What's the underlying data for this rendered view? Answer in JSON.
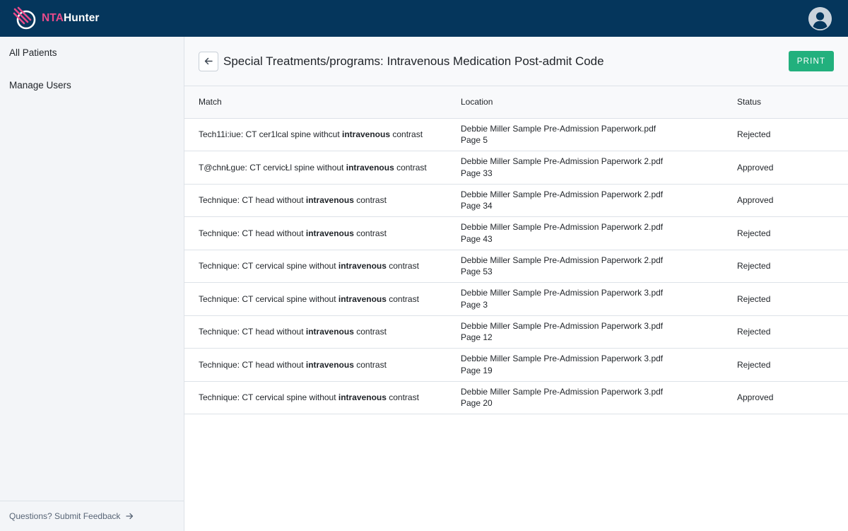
{
  "app": {
    "logo_part1": "NTA",
    "logo_part2": "Hunter",
    "colors": {
      "topbar": "#05365c",
      "accent_pink": "#e84b8a",
      "print_button": "#22b07d"
    }
  },
  "sidebar": {
    "items": [
      {
        "label": "All Patients"
      },
      {
        "label": "Manage Users"
      }
    ],
    "footer_label": "Questions? Submit Feedback",
    "footer_icon": "arrow-right-icon"
  },
  "header": {
    "back_icon": "arrow-left-icon",
    "title": "Special Treatments/programs: Intravenous Medication Post-admit Code",
    "print_label": "PRINT"
  },
  "table": {
    "columns": [
      "Match",
      "Location",
      "Status"
    ],
    "rows": [
      {
        "pre": "Tech11i:iue: CT cer1lcal spine withcut ",
        "keyword": "intravenous",
        "post": " contrast",
        "file": "Debbie Miller Sample Pre-Admission Paperwork.pdf",
        "page": "Page 5",
        "status": "Rejected"
      },
      {
        "pre": "T@chnŁgue: CT cervicŁl spine without ",
        "keyword": "intravenous",
        "post": " contrast",
        "file": "Debbie Miller Sample Pre-Admission Paperwork 2.pdf",
        "page": "Page 33",
        "status": "Approved"
      },
      {
        "pre": "Technique: CT head without ",
        "keyword": "intravenous",
        "post": " contrast",
        "file": "Debbie Miller Sample Pre-Admission Paperwork 2.pdf",
        "page": "Page 34",
        "status": "Approved"
      },
      {
        "pre": "Technique: CT head without ",
        "keyword": "intravenous",
        "post": " contrast",
        "file": "Debbie Miller Sample Pre-Admission Paperwork 2.pdf",
        "page": "Page 43",
        "status": "Rejected"
      },
      {
        "pre": "Technique: CT cervical spine without ",
        "keyword": "intravenous",
        "post": " contrast",
        "file": "Debbie Miller Sample Pre-Admission Paperwork 2.pdf",
        "page": "Page 53",
        "status": "Rejected"
      },
      {
        "pre": "Technique: CT cervical spine without ",
        "keyword": "intravenous",
        "post": " contrast",
        "file": "Debbie Miller Sample Pre-Admission Paperwork 3.pdf",
        "page": "Page 3",
        "status": "Rejected"
      },
      {
        "pre": "Technique: CT head without ",
        "keyword": "intravenous",
        "post": " contrast",
        "file": "Debbie Miller Sample Pre-Admission Paperwork 3.pdf",
        "page": "Page 12",
        "status": "Rejected"
      },
      {
        "pre": "Technique: CT head without ",
        "keyword": "intravenous",
        "post": " contrast",
        "file": "Debbie Miller Sample Pre-Admission Paperwork 3.pdf",
        "page": "Page 19",
        "status": "Rejected"
      },
      {
        "pre": "Technique: CT cervical spine without ",
        "keyword": "intravenous",
        "post": " contrast",
        "file": "Debbie Miller Sample Pre-Admission Paperwork 3.pdf",
        "page": "Page 20",
        "status": "Approved"
      }
    ]
  }
}
